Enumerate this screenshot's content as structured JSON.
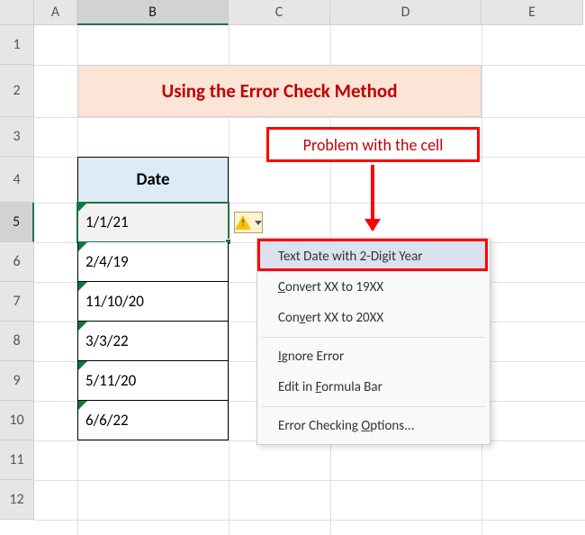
{
  "columns": [
    "A",
    "B",
    "C",
    "D",
    "E"
  ],
  "rows": [
    "1",
    "2",
    "3",
    "4",
    "5",
    "6",
    "7",
    "8",
    "9",
    "10",
    "11",
    "12"
  ],
  "title": "Using the Error Check Method",
  "date_header": "Date",
  "dates": [
    "1/1/21",
    "2/4/19",
    "11/10/20",
    "3/3/22",
    "5/11/20",
    "6/6/22"
  ],
  "callout": "Problem with the cell",
  "menu": {
    "header": "Text Date with 2-Digit Year",
    "convert19": "Convert XX to 19XX",
    "convert20": "Convert XX to 20XX",
    "ignore": "Ignore Error",
    "edit": "Edit in Formula Bar",
    "options": "Error Checking Options..."
  },
  "colors": {
    "accent": "#217346",
    "titlebg": "#fce4d6",
    "titlefg": "#c00000",
    "headerbg": "#ddebf7"
  }
}
